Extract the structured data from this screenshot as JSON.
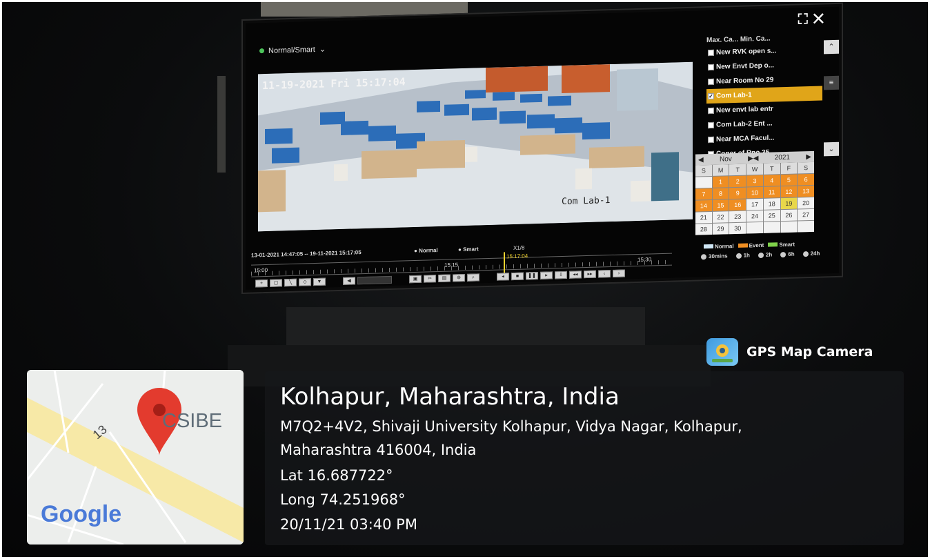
{
  "monitor": {
    "mode_label": "Normal/Smart",
    "osd_timestamp": "11-19-2021 Fri 15:17:04",
    "camera_name_overlay": "Com Lab-1",
    "camera_list_header": "Max. Ca...   Min. Ca...",
    "camera_list": [
      {
        "label": "New RVK open s...",
        "checked": false
      },
      {
        "label": "New Envt Dep o...",
        "checked": false
      },
      {
        "label": "Near Room No 29",
        "checked": false
      },
      {
        "label": "Com Lab-1",
        "checked": true
      },
      {
        "label": "New envt lab entr",
        "checked": false
      },
      {
        "label": "Com Lab-2 Ent ...",
        "checked": false
      },
      {
        "label": "Near MCA Facul...",
        "checked": false
      },
      {
        "label": "Coner of Rno 35",
        "checked": false
      }
    ],
    "calendar": {
      "month": "Nov",
      "year": "2021",
      "weekdays": [
        "S",
        "M",
        "T",
        "W",
        "T",
        "F",
        "S"
      ],
      "rows": [
        [
          "",
          "1",
          "2",
          "3",
          "4",
          "5",
          "6"
        ],
        [
          "7",
          "8",
          "9",
          "10",
          "11",
          "12",
          "13"
        ],
        [
          "14",
          "15",
          "16",
          "17",
          "18",
          "19",
          "20"
        ],
        [
          "21",
          "22",
          "23",
          "24",
          "25",
          "26",
          "27"
        ],
        [
          "28",
          "29",
          "30",
          "",
          "",
          "",
          ""
        ]
      ],
      "event_days": [
        "1",
        "2",
        "3",
        "4",
        "5",
        "6",
        "7",
        "8",
        "9",
        "10",
        "11",
        "12",
        "13",
        "14",
        "15",
        "16"
      ],
      "smart_days": [
        "19"
      ]
    },
    "legend": {
      "normal": "Normal",
      "event": "Event",
      "smart": "Smart"
    },
    "timeline": {
      "range_text": "13-01-2021 14:47:05 -- 19-11-2021 15:17:05",
      "radio_normal": "Normal",
      "radio_smart": "Smart",
      "speed": "X1/8",
      "tick_left": "15:00",
      "tick_mid": "15:15",
      "tick_right": "15:30",
      "cursor_time": "15:17:04"
    },
    "ranges": [
      "30mins",
      "1h",
      "2h",
      "6h",
      "24h"
    ]
  },
  "overlay": {
    "app_name": "GPS Map Camera",
    "map_label": "CSIBE",
    "map_road_label": "13",
    "google_logo": "Google",
    "location_title": "Kolhapur, Maharashtra, India",
    "address_line1": "M7Q2+4V2, Shivaji University Kolhapur, Vidya Nagar, Kolhapur,",
    "address_line2": "Maharashtra 416004, India",
    "lat": "Lat 16.687722°",
    "long": "Long 74.251968°",
    "datetime": "20/11/21 03:40 PM"
  },
  "colors": {
    "selected_camera": "#e0a519",
    "event_day": "#ef8e22",
    "smart_day": "#e8d74a",
    "timeline_cursor": "#f1d330"
  }
}
